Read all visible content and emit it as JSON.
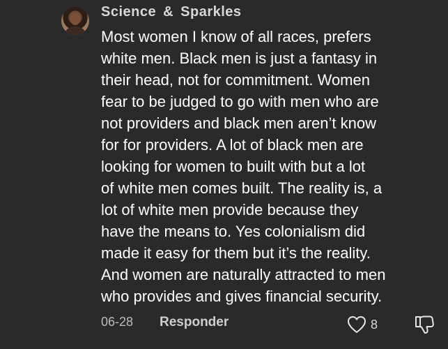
{
  "comment": {
    "username": "Science  &  Sparkles",
    "avatar_icon": "profile-photo",
    "lines": [
      "Most women I know of all races, prefers",
      "white men. Black men is just a fantasy in",
      "their head, not for commitment. Women",
      "fear to be judged to go with men who are",
      "not providers and black men aren’t know",
      "for for providers. A lot of black men are",
      "looking for women to built with but a lot",
      "of white men comes built. The reality is, a",
      "lot of white men provide because they",
      "have the means to. Yes colonialism did",
      "made it easy for them but it’s the reality.",
      "And women are naturally attracted to men",
      "who provides and gives financial security."
    ],
    "date": "06-28",
    "reply_label": "Responder",
    "like_count": "8",
    "like_icon": "heart-outline-icon",
    "dislike_icon": "thumbs-down-icon"
  },
  "colors": {
    "background": "#2a2a2a",
    "text": "#ffffff",
    "secondary_text": "#bdbdbd"
  }
}
